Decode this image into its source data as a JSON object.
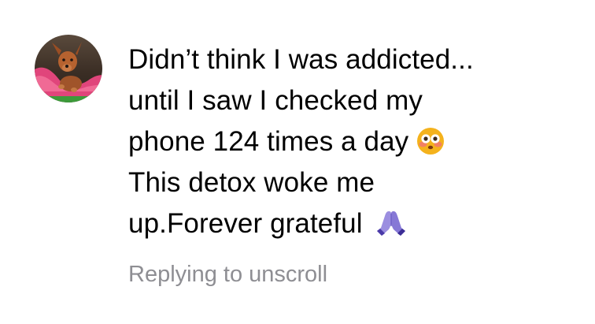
{
  "comment": {
    "avatar_icon": "puppy-avatar",
    "lines": [
      "Didn’t think I was addicted...",
      "until I saw I checked my",
      "phone 124 times a day",
      "This detox woke me",
      "up.Forever grateful"
    ],
    "emojis": {
      "flushed": "flushed-face-icon",
      "praying": "folded-hands-icon"
    },
    "replying_to": "Replying to unscroll"
  }
}
